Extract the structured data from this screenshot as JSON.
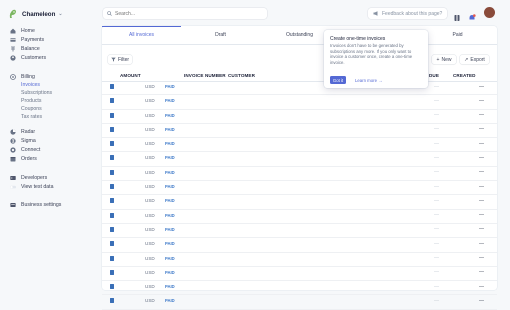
{
  "app": {
    "name": "Chameleon"
  },
  "colors": {
    "accent": "#5469d4",
    "paid": "#3d79c9",
    "text": "#3c4257"
  },
  "sidebar": {
    "items": [
      {
        "label": "Home",
        "icon": "home-icon"
      },
      {
        "label": "Payments",
        "icon": "payments-icon"
      },
      {
        "label": "Balance",
        "icon": "balance-icon"
      },
      {
        "label": "Customers",
        "icon": "customers-icon"
      },
      {
        "label": "Billing",
        "icon": "billing-icon"
      },
      {
        "label": "Radar",
        "icon": "radar-icon"
      },
      {
        "label": "Sigma",
        "icon": "sigma-icon"
      },
      {
        "label": "Connect",
        "icon": "connect-icon"
      },
      {
        "label": "Orders",
        "icon": "orders-icon"
      },
      {
        "label": "Developers",
        "icon": "developers-icon"
      },
      {
        "label": "View test data",
        "icon": "toggle-icon"
      },
      {
        "label": "Business settings",
        "icon": "settings-icon"
      }
    ],
    "billing_sub": [
      "Invoices",
      "Subscriptions",
      "Products",
      "Coupons",
      "Tax rates"
    ]
  },
  "search": {
    "placeholder": "Search..."
  },
  "feedback": {
    "label": "Feedback about this page?"
  },
  "tabs": [
    "All invoices",
    "Draft",
    "Outstanding",
    "Past due",
    "Paid"
  ],
  "toolbar": {
    "filter": "Filter",
    "new": "New",
    "export": "Export"
  },
  "table": {
    "columns": {
      "amount": "AMOUNT",
      "invoice_number": "INVOICE NUMBER",
      "customer": "CUSTOMER",
      "due": "DUE",
      "created": "CREATED"
    },
    "rows": [
      {
        "currency": "USD",
        "status": "PAID",
        "due": "—",
        "created": "—"
      },
      {
        "currency": "USD",
        "status": "PAID",
        "due": "—",
        "created": "—"
      },
      {
        "currency": "USD",
        "status": "PAID",
        "due": "—",
        "created": "—"
      },
      {
        "currency": "USD",
        "status": "PAID",
        "due": "—",
        "created": "—"
      },
      {
        "currency": "USD",
        "status": "PAID",
        "due": "—",
        "created": "—"
      },
      {
        "currency": "USD",
        "status": "PAID",
        "due": "—",
        "created": "—"
      },
      {
        "currency": "USD",
        "status": "PAID",
        "due": "—",
        "created": "—"
      },
      {
        "currency": "USD",
        "status": "PAID",
        "due": "—",
        "created": "—"
      },
      {
        "currency": "USD",
        "status": "PAID",
        "due": "—",
        "created": "—"
      },
      {
        "currency": "USD",
        "status": "PAID",
        "due": "—",
        "created": "—"
      },
      {
        "currency": "USD",
        "status": "PAID",
        "due": "—",
        "created": "—"
      },
      {
        "currency": "USD",
        "status": "PAID",
        "due": "—",
        "created": "—"
      },
      {
        "currency": "USD",
        "status": "PAID",
        "due": "—",
        "created": "—"
      },
      {
        "currency": "USD",
        "status": "PAID",
        "due": "—",
        "created": "—"
      },
      {
        "currency": "USD",
        "status": "PAID",
        "due": "—",
        "created": "—"
      },
      {
        "currency": "USD",
        "status": "PAID",
        "due": "—",
        "created": "—"
      }
    ]
  },
  "popover": {
    "title": "Create one-time invoices",
    "body": "Invoices don't have to be generated by subscriptions any more. If you only want to invoice a customer once, create a one-time invoice.",
    "got_it": "Got it",
    "learn_more": "Learn more →"
  }
}
